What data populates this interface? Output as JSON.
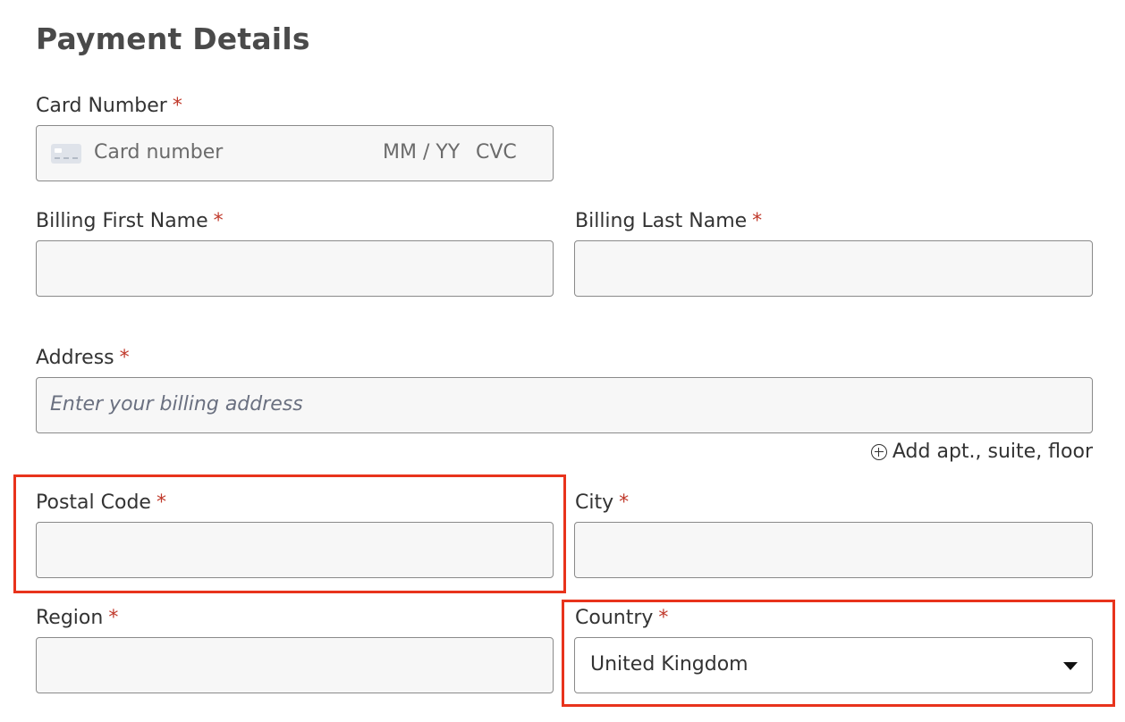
{
  "form": {
    "title": "Payment Details",
    "required_marker": "*",
    "card": {
      "label": "Card Number",
      "number_placeholder": "Card number",
      "expiry_placeholder": "MM / YY",
      "cvc_placeholder": "CVC"
    },
    "first_name": {
      "label": "Billing First Name",
      "value": ""
    },
    "last_name": {
      "label": "Billing Last Name",
      "value": ""
    },
    "address": {
      "label": "Address",
      "placeholder": "Enter your billing address",
      "add_line_label": "Add apt., suite, floor"
    },
    "postal_code": {
      "label": "Postal Code",
      "value": ""
    },
    "city": {
      "label": "City",
      "value": ""
    },
    "region": {
      "label": "Region",
      "value": ""
    },
    "country": {
      "label": "Country",
      "selected": "United Kingdom"
    }
  },
  "colors": {
    "required": "#c0392b",
    "highlight": "#e8331c",
    "field_background": "#f7f7f7",
    "field_border": "#8a8a8a"
  }
}
